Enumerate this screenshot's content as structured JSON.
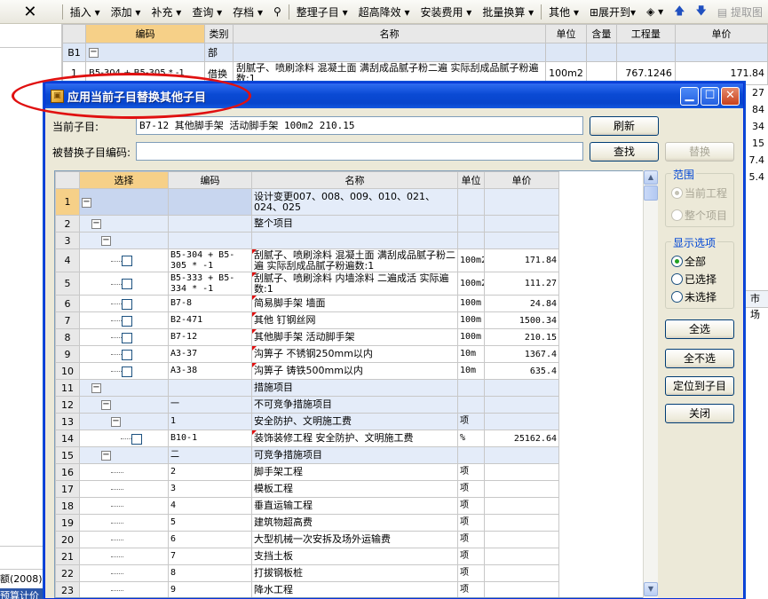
{
  "background": {
    "toolbar": [
      "插入",
      "添加",
      "补充",
      "查询",
      "存档",
      "整理子目",
      "超高降效",
      "安装费用",
      "批量换算",
      "其他",
      "展开到",
      "提取图"
    ],
    "table_headers": [
      "编码",
      "类别",
      "名称",
      "单位",
      "含量",
      "工程量",
      "单价"
    ],
    "row_b1": {
      "num": "B1",
      "type": "部"
    },
    "row_1": {
      "num": "1",
      "code": "B5-304 + B5-305 * -1",
      "type": "借换",
      "name": "刮腻子、喷刷涂料 混凝土面 满刮成品腻子粉二遍 实际刮成品腻子粉遍数:1",
      "unit": "100m2",
      "qty": "767.1246",
      "price": "171.84"
    },
    "right_numbers": [
      "27",
      "84",
      "34",
      "15",
      "7.4",
      "5.4"
    ],
    "right_cell": "市场",
    "bottom_text": "额(2008)",
    "bottom_text2": "预算计价"
  },
  "dialog": {
    "title": "应用当前子目替换其他子目",
    "current_label": "当前子目:",
    "current_value": "B7-12  其他脚手架 活动脚手架  100m2  210.15",
    "replaced_label": "被替换子目编码:",
    "replaced_value": "",
    "buttons": {
      "refresh": "刷新",
      "find": "查找",
      "replace": "替换",
      "select_all": "全选",
      "deselect_all": "全不选",
      "locate": "定位到子目",
      "close": "关闭"
    },
    "scope": {
      "title": "范围",
      "current_project": "当前工程",
      "whole_project": "整个项目"
    },
    "display": {
      "title": "显示选项",
      "all": "全部",
      "selected": "已选择",
      "unselected": "未选择"
    },
    "grid_headers": {
      "select": "选择",
      "code": "编码",
      "name": "名称",
      "unit": "单位",
      "price": "单价"
    },
    "rows": [
      {
        "n": "1",
        "code": "",
        "name": "设计变更007、008、009、010、021、024、025",
        "unit": "",
        "price": ""
      },
      {
        "n": "2",
        "code": "",
        "name": "整个项目",
        "unit": "",
        "price": ""
      },
      {
        "n": "3",
        "code": "",
        "name": "",
        "unit": "",
        "price": ""
      },
      {
        "n": "4",
        "code": "B5-304 + B5-305 * -1",
        "name": "刮腻子、喷刷涂料 混凝土面 满刮成品腻子粉二遍 实际刮成品腻子粉遍数:1",
        "unit": "100m2",
        "price": "171.84"
      },
      {
        "n": "5",
        "code": "B5-333 + B5-334 * -1",
        "name": "刮腻子、喷刷涂料 内墙涂料 二遍成活 实际遍数:1",
        "unit": "100m2",
        "price": "111.27"
      },
      {
        "n": "6",
        "code": "B7-8",
        "name": "简易脚手架 墙面",
        "unit": "100m",
        "price": "24.84"
      },
      {
        "n": "7",
        "code": "B2-471",
        "name": "其他 钉钢丝网",
        "unit": "100m",
        "price": "1500.34"
      },
      {
        "n": "8",
        "code": "B7-12",
        "name": "其他脚手架 活动脚手架",
        "unit": "100m",
        "price": "210.15"
      },
      {
        "n": "9",
        "code": "A3-37",
        "name": "沟箅子 不锈钢250mm以内",
        "unit": "10m",
        "price": "1367.4"
      },
      {
        "n": "10",
        "code": "A3-38",
        "name": "沟箅子 铸铁500mm以内",
        "unit": "10m",
        "price": "635.4"
      },
      {
        "n": "11",
        "code": "",
        "name": "措施项目",
        "unit": "",
        "price": ""
      },
      {
        "n": "12",
        "code": "一",
        "name": "不可竞争措施项目",
        "unit": "",
        "price": ""
      },
      {
        "n": "13",
        "code": "1",
        "name": "安全防护、文明施工费",
        "unit": "项",
        "price": ""
      },
      {
        "n": "14",
        "code": "B10-1",
        "name": "装饰装修工程 安全防护、文明施工费",
        "unit": "%",
        "price": "25162.64"
      },
      {
        "n": "15",
        "code": "二",
        "name": "可竞争措施项目",
        "unit": "",
        "price": ""
      },
      {
        "n": "16",
        "code": "2",
        "name": "脚手架工程",
        "unit": "项",
        "price": ""
      },
      {
        "n": "17",
        "code": "3",
        "name": "模板工程",
        "unit": "项",
        "price": ""
      },
      {
        "n": "18",
        "code": "4",
        "name": "垂直运输工程",
        "unit": "项",
        "price": ""
      },
      {
        "n": "19",
        "code": "5",
        "name": "建筑物超高费",
        "unit": "项",
        "price": ""
      },
      {
        "n": "20",
        "code": "6",
        "name": "大型机械一次安拆及场外运输费",
        "unit": "项",
        "price": ""
      },
      {
        "n": "21",
        "code": "7",
        "name": "支挡土板",
        "unit": "项",
        "price": ""
      },
      {
        "n": "22",
        "code": "8",
        "name": "打拔钢板桩",
        "unit": "项",
        "price": ""
      },
      {
        "n": "23",
        "code": "9",
        "name": "降水工程",
        "unit": "项",
        "price": ""
      }
    ]
  }
}
